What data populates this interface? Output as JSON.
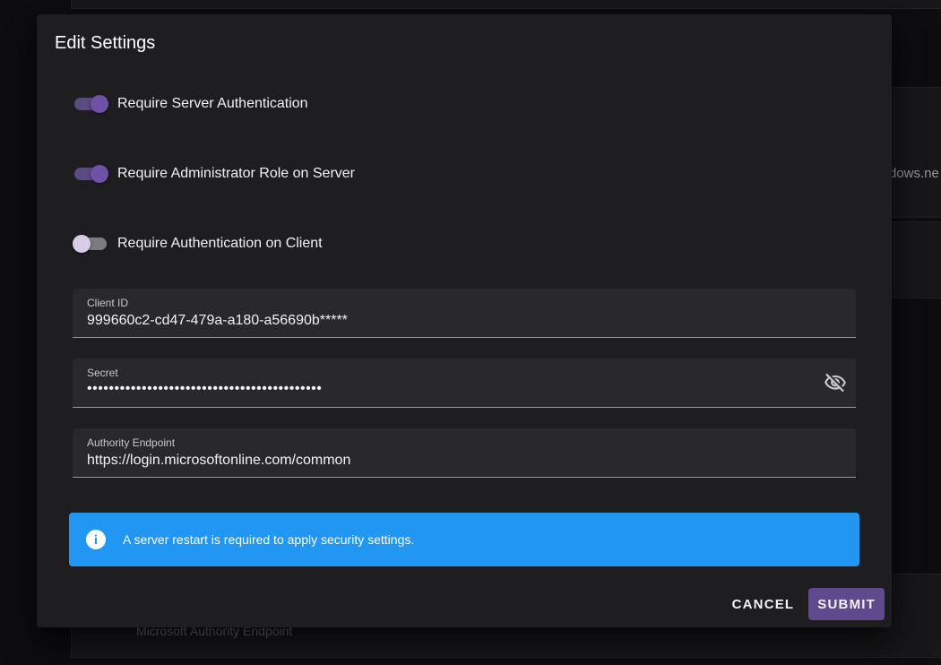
{
  "background": {
    "partial_text": "dows.ne",
    "bottom_text": "Microsoft Authority Endpoint"
  },
  "dialog": {
    "title": "Edit Settings",
    "switches": [
      {
        "label": "Require Server Authentication",
        "checked": true
      },
      {
        "label": "Require Administrator Role on Server",
        "checked": true
      },
      {
        "label": "Require Authentication on Client",
        "checked": false
      }
    ],
    "fields": {
      "client_id": {
        "label": "Client ID",
        "value": "999660c2-cd47-479a-a180-a56690b*****"
      },
      "secret": {
        "label": "Secret",
        "value": "•••••••••••••••••••••••••••••••••••••••••••"
      },
      "authority_endpoint": {
        "label": "Authority Endpoint",
        "value": "https://login.microsoftonline.com/common"
      }
    },
    "alert": {
      "icon": "info-icon",
      "text": "A server restart is required to apply security settings.",
      "color": "#2196f3"
    },
    "actions": {
      "cancel_label": "CANCEL",
      "submit_label": "SUBMIT"
    }
  },
  "colors": {
    "accent": "#6f52a8",
    "submit_bg": "#5f4a8e",
    "dialog_bg": "#1e1e21"
  }
}
